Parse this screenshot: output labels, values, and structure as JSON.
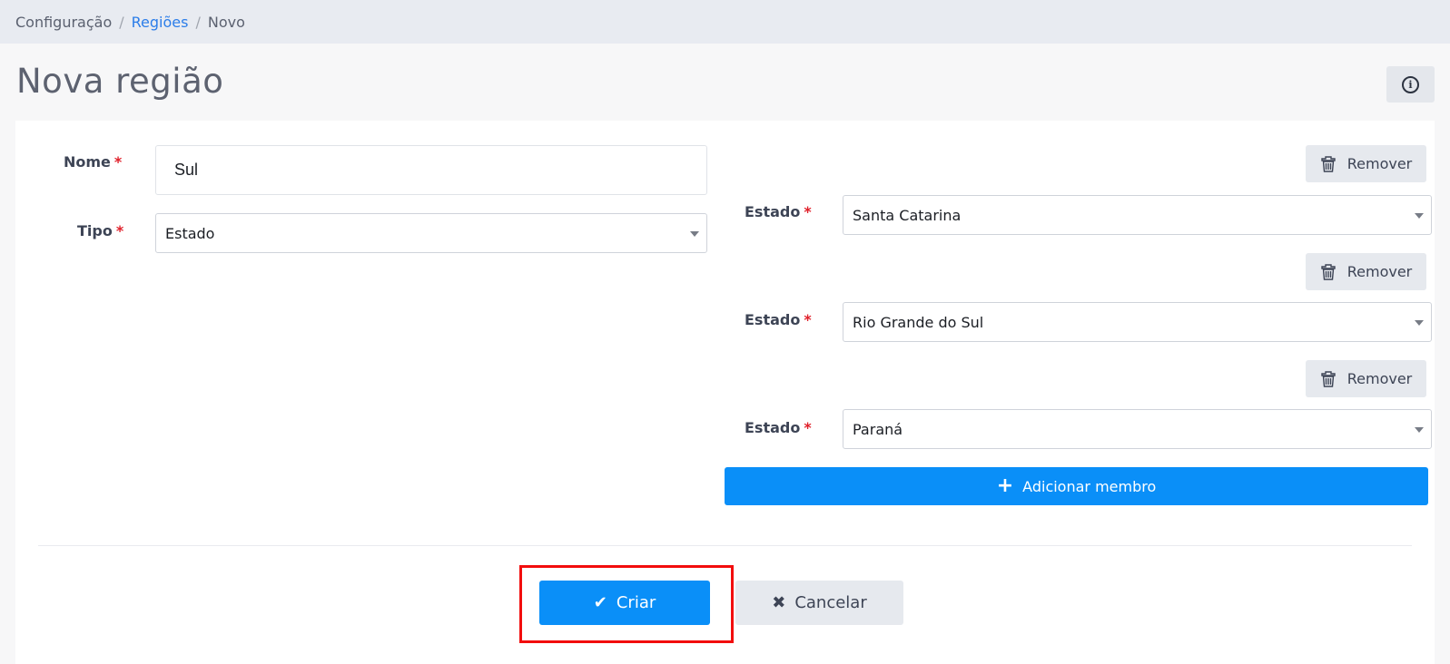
{
  "breadcrumb": {
    "root": "Configuração",
    "section": "Regiões",
    "current": "Novo",
    "separator": "/"
  },
  "page": {
    "title": "Nova região",
    "info_icon": "info-icon"
  },
  "form": {
    "required_marker": "*",
    "name": {
      "label": "Nome",
      "value": "Sul"
    },
    "type": {
      "label": "Tipo",
      "value": "Estado"
    }
  },
  "members": {
    "remove_label": "Remover",
    "state_label": "Estado",
    "items": [
      {
        "value": "Santa Catarina"
      },
      {
        "value": "Rio Grande do Sul"
      },
      {
        "value": "Paraná"
      }
    ],
    "add_label": "Adicionar membro"
  },
  "actions": {
    "create_label": "Criar",
    "cancel_label": "Cancelar"
  },
  "colors": {
    "primary": "#0a8ff8",
    "required": "#e0202a",
    "highlight": "#f20d0d"
  }
}
